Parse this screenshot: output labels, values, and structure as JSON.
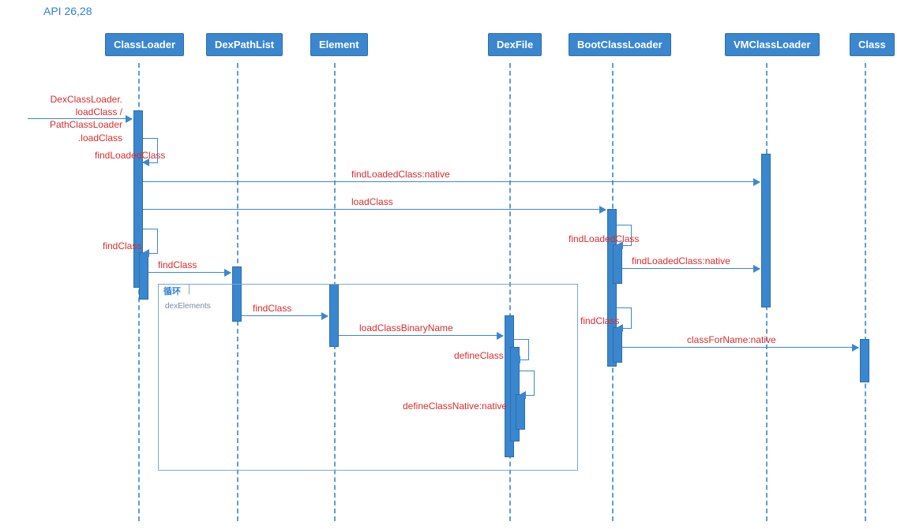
{
  "title": "API 26,28",
  "participants": {
    "classloader": "ClassLoader",
    "dexpathlist": "DexPathList",
    "element": "Element",
    "dexfile": "DexFile",
    "bootclassloader": "BootClassLoader",
    "vmclassloader": "VMClassLoader",
    "class": "Class"
  },
  "left_note": {
    "l1": "DexClassLoader.",
    "l2": "loadClass /",
    "l3": "PathClassLoader",
    "l4": ".loadClass"
  },
  "messages": {
    "findLoadedClass": "findLoadedClass",
    "findLoadedClass_native": "findLoadedClass:native",
    "loadClass": "loadClass",
    "findClass": "findClass",
    "loadClassBinaryName": "loadClassBinaryName",
    "defineClass": "defineClass",
    "defineClassNative": "defineClassNative:native",
    "classForName": "classForName:native"
  },
  "fragment": {
    "operator": "循环",
    "guard": "dexElements"
  },
  "chart_data": {
    "type": "sequence-diagram",
    "title": "API 26,28",
    "participants": [
      "ClassLoader",
      "DexPathList",
      "Element",
      "DexFile",
      "BootClassLoader",
      "VMClassLoader",
      "Class"
    ],
    "messages": [
      {
        "from": "(caller)",
        "to": "ClassLoader",
        "label": "DexClassLoader.loadClass / PathClassLoader.loadClass"
      },
      {
        "from": "ClassLoader",
        "to": "ClassLoader",
        "label": "findLoadedClass",
        "self": true
      },
      {
        "from": "ClassLoader",
        "to": "VMClassLoader",
        "label": "findLoadedClass:native"
      },
      {
        "from": "ClassLoader",
        "to": "BootClassLoader",
        "label": "loadClass"
      },
      {
        "from": "ClassLoader",
        "to": "ClassLoader",
        "label": "findClass",
        "self": true
      },
      {
        "from": "BootClassLoader",
        "to": "BootClassLoader",
        "label": "findLoadedClass",
        "self": true
      },
      {
        "from": "BootClassLoader",
        "to": "VMClassLoader",
        "label": "findLoadedClass:native"
      },
      {
        "from": "ClassLoader",
        "to": "DexPathList",
        "label": "findClass"
      },
      {
        "fragment": "loop",
        "operator": "循环",
        "guard": "dexElements",
        "messages": [
          {
            "from": "DexPathList",
            "to": "Element",
            "label": "findClass"
          },
          {
            "from": "Element",
            "to": "DexFile",
            "label": "loadClassBinaryName"
          },
          {
            "from": "DexFile",
            "to": "DexFile",
            "label": "defineClass",
            "self": true
          },
          {
            "from": "DexFile",
            "to": "DexFile",
            "label": "defineClassNative:native",
            "self": true
          }
        ]
      },
      {
        "from": "BootClassLoader",
        "to": "BootClassLoader",
        "label": "findClass",
        "self": true
      },
      {
        "from": "BootClassLoader",
        "to": "Class",
        "label": "classForName:native"
      }
    ]
  }
}
